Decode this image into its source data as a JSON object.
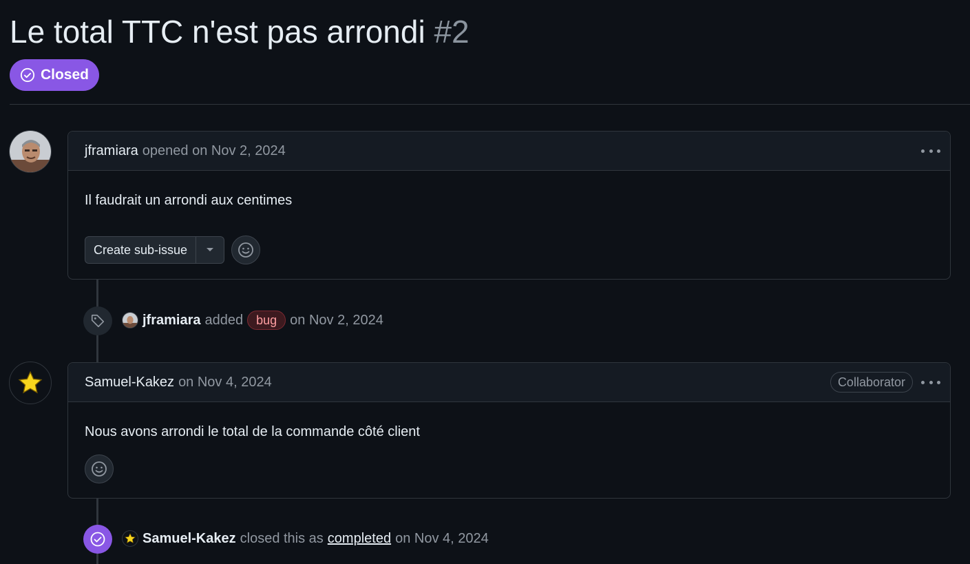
{
  "issue": {
    "title": "Le total TTC n'est pas arrondi",
    "number": "#2",
    "status": "Closed",
    "status_color": "#8957e5"
  },
  "comments": [
    {
      "author": "jframiara",
      "meta": "opened on Nov 2, 2024",
      "body": "Il faudrait un arrondi aux centimes",
      "create_sub_issue_label": "Create sub-issue"
    },
    {
      "author": "Samuel-Kakez",
      "meta": "on Nov 4, 2024",
      "badge": "Collaborator",
      "body": "Nous avons arrondi le total de la commande côté client"
    }
  ],
  "events": [
    {
      "icon": "tag-icon",
      "actor": "jframiara",
      "action": "added",
      "label": "bug",
      "label_color": "#ff9ea1",
      "date": "on Nov 2, 2024"
    },
    {
      "icon": "check-circle-icon",
      "actor": "Samuel-Kakez",
      "action": "closed this as",
      "link": "completed",
      "date": "on Nov 4, 2024"
    }
  ]
}
